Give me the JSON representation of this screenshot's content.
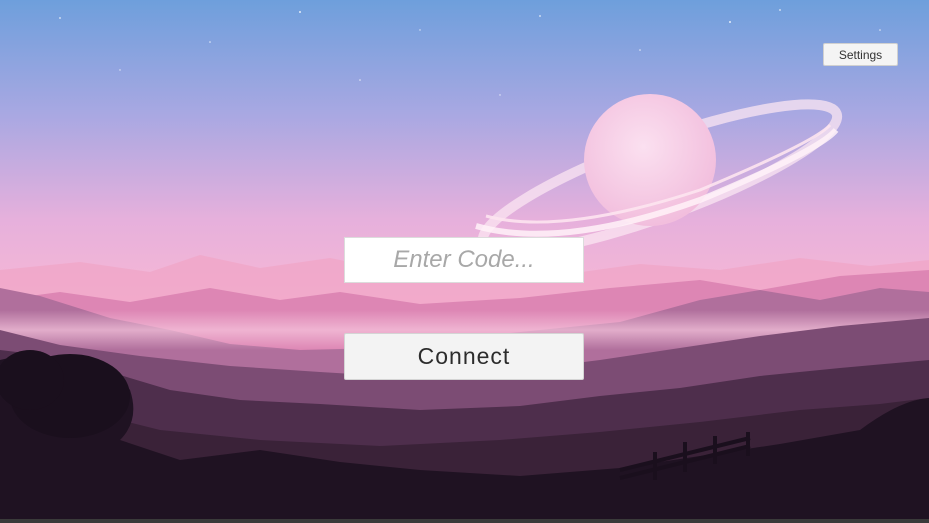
{
  "screen": {
    "background": "pink sunset landscape with ringed planet",
    "colors": {
      "sky_top": "#7aa4dc",
      "sky_mid": "#c6a2dc",
      "sky_pink": "#f6b4d2",
      "mountain_far": "#e08cb8",
      "mountain_mid": "#a06a92",
      "mountain_dark": "#3a2238",
      "foreground": "#1c1020"
    }
  },
  "settings": {
    "label": "Settings"
  },
  "code_input": {
    "value": "",
    "placeholder": "Enter Code..."
  },
  "connect": {
    "label": "Connect"
  }
}
